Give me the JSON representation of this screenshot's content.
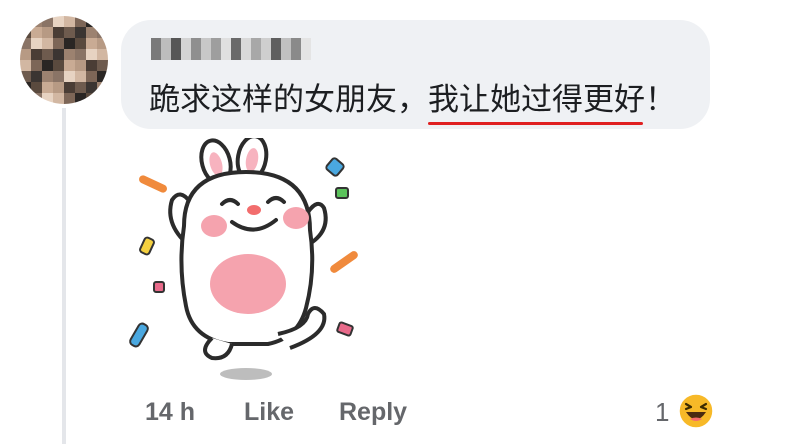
{
  "comment": {
    "text_before": "跪求这样的女朋友，",
    "text_highlight": "我让她过得更好",
    "text_after": "！"
  },
  "sticker": {
    "icon": "cheering-bunny-sticker"
  },
  "actions": {
    "time": "14 h",
    "like_label": "Like",
    "reply_label": "Reply"
  },
  "reactions": {
    "count": "1",
    "icon": "haha-emoji-icon"
  },
  "colors": {
    "bubble": "#eff1f4",
    "meta_text": "#65676b",
    "underline": "#e02020",
    "haha_yellow": "#f7b928"
  }
}
